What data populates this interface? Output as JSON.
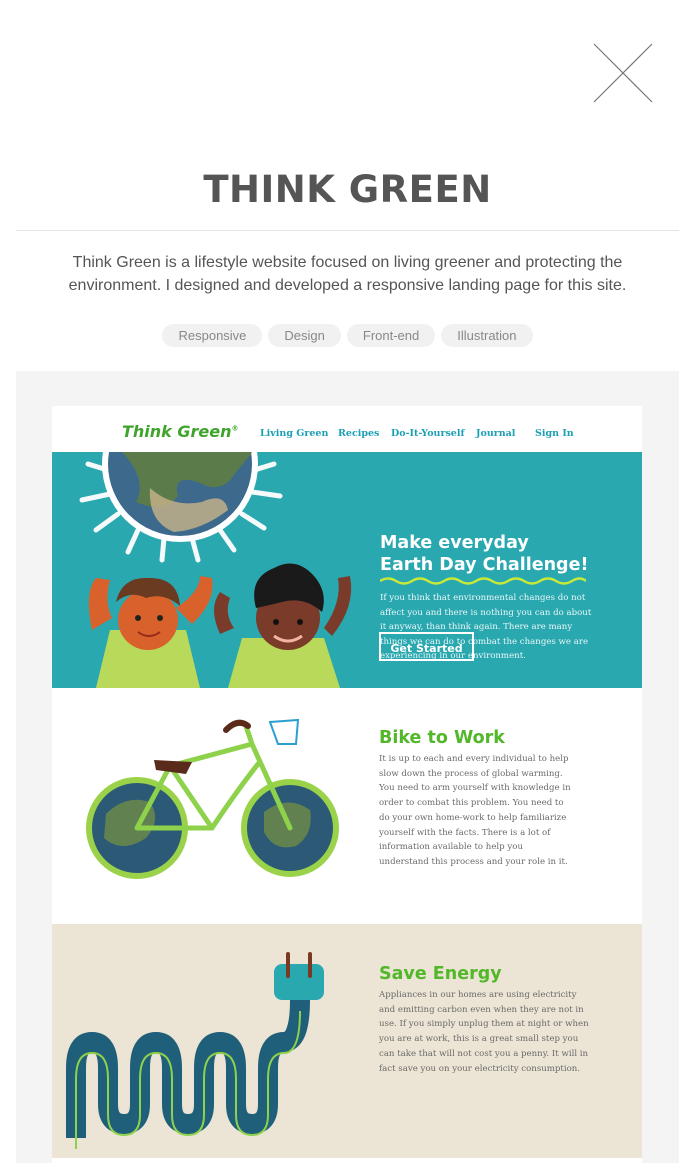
{
  "modal": {
    "close_icon": "close-icon",
    "title": "THINK GREEN",
    "description": "Think Green is a lifestyle website focused on living greener and protecting the environment. I designed and developed a responsive landing page for this site.",
    "tags": [
      "Responsive",
      "Design",
      "Front-end",
      "Illustration"
    ]
  },
  "screenshot": {
    "nav": {
      "logo": "Think Green",
      "logo_mark": "®",
      "links": [
        "Living Green",
        "Recipes",
        "Do-It-Yourself",
        "Journal",
        "Sign In"
      ]
    },
    "hero": {
      "title_line1": "Make everyday",
      "title_line2": "Earth Day Challenge!",
      "text": "If you think that environmental changes do not affect you and there is nothing you can do about it anyway, than think again. There are many things we can do to combat the changes we are experiencing in our environment.",
      "button": "Get Started"
    },
    "bike": {
      "title": "Bike to Work",
      "text": "It is up to each and every individual to help slow down the process of global warming. You need to arm yourself with knowledge in order to combat this problem. You need to do your own home-work to help familiarize yourself with the facts. There is a lot of information available to help you understand this process and your role in it."
    },
    "energy": {
      "title": "Save Energy",
      "text": "Appliances in our homes are using electricity and emitting carbon even when they are not in use. If you simply unplug them at night or when you are at work, this is a great small step you can take that will not cost you a penny. It will in fact save you on your electricity consumption."
    }
  },
  "colors": {
    "title_gray": "#555555",
    "tag_bg": "#f1f1f1",
    "brand_green": "#3fa42c",
    "hero_teal": "#2aa8b0",
    "link_teal": "#1a9fb5"
  }
}
